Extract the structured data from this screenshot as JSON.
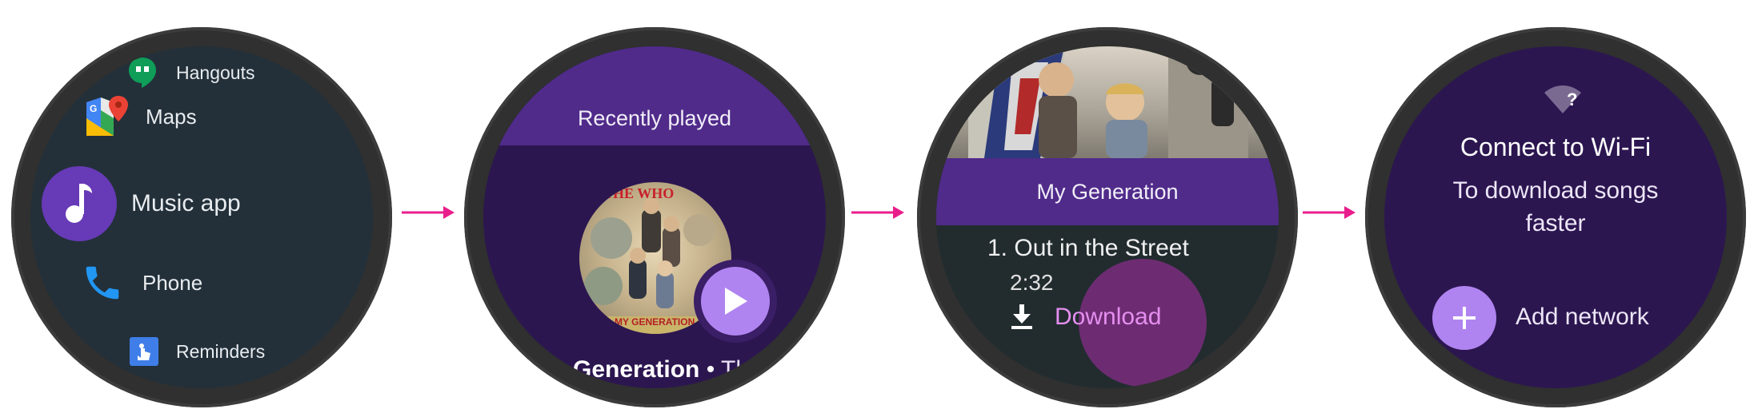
{
  "launcher": {
    "apps": [
      {
        "label": "Hangouts",
        "icon": "hangouts-icon"
      },
      {
        "label": "Maps",
        "icon": "maps-icon"
      },
      {
        "label": "Music app",
        "icon": "music-note-icon"
      },
      {
        "label": "Phone",
        "icon": "phone-icon"
      },
      {
        "label": "Reminders",
        "icon": "reminders-icon"
      }
    ]
  },
  "recent": {
    "header": "Recently played",
    "album_label": "THE WHO",
    "album_footer": "MY GENERATION",
    "title": "My Generation",
    "separator": " • ",
    "artist": "The Who",
    "play_icon": "play-icon"
  },
  "album": {
    "header": "My Generation",
    "track": "1. Out in the Street",
    "duration": "2:32",
    "download_label": "Download",
    "download_icon": "download-icon"
  },
  "wifi": {
    "title": "Connect to Wi-Fi",
    "subtitle": "To download songs faster",
    "add_label": "Add network",
    "icon": "wifi-unknown-icon"
  },
  "colors": {
    "accent_purple": "#673ab7",
    "light_purple": "#b084f0",
    "banner_purple": "#502b8a",
    "arrow_magenta": "#e91e8c"
  }
}
